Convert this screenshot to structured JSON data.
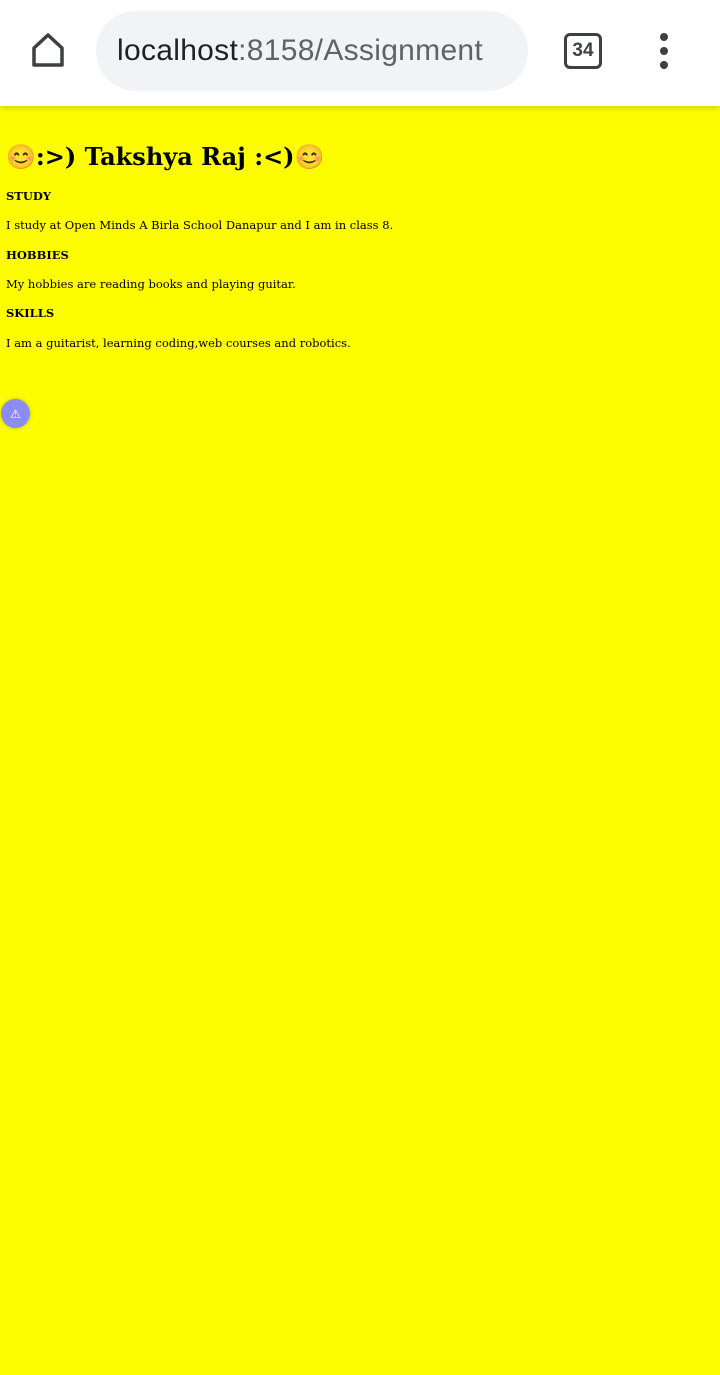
{
  "browser": {
    "url_host": "localhost",
    "url_path": ":8158/Assignment",
    "tab_count": "34",
    "icons": {
      "home": "home-icon",
      "menu": "more-vert-icon",
      "tabs": "tab-switcher-icon"
    }
  },
  "page": {
    "background": "#fefd00",
    "title": "😊:>) Takshya Raj :<)😊",
    "sections": [
      {
        "heading": "STUDY",
        "text": "I study at Open Minds A Birla School Danapur and I am in class 8."
      },
      {
        "heading": "HOBBIES",
        "text": "My hobbies are reading books and playing guitar."
      },
      {
        "heading": "SKILLS",
        "text": "I am a guitarist, learning coding,web courses and robotics."
      }
    ],
    "warning_badge": {
      "glyph": "⚠",
      "icon": "warning-icon",
      "color": "#8c8cf5"
    }
  }
}
